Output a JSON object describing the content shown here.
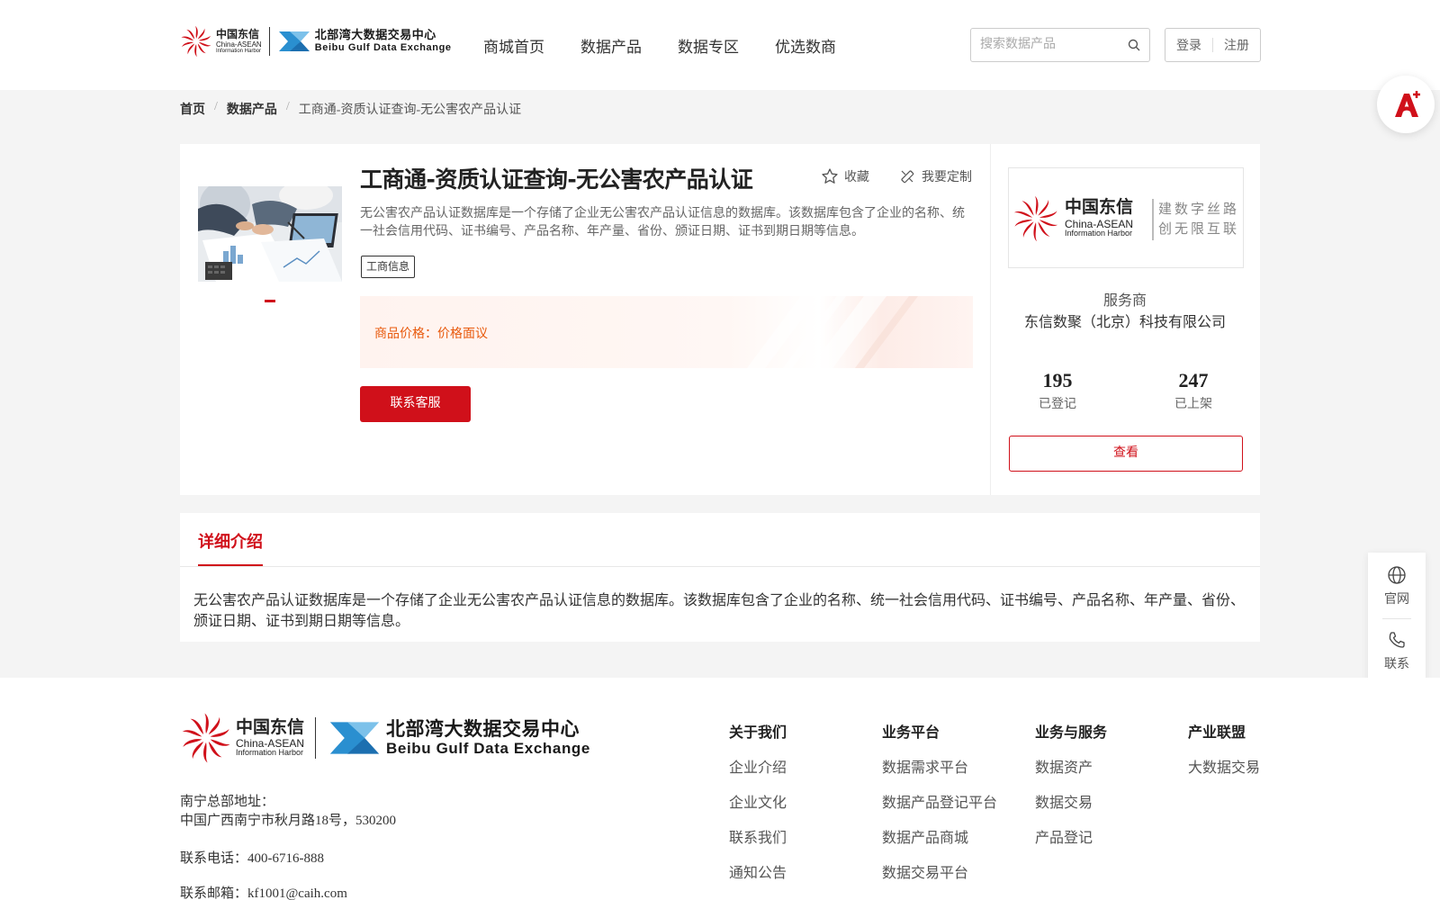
{
  "header": {
    "logo_cn_title": "中国东信",
    "logo_cn_en1": "China-ASEAN",
    "logo_cn_en2": "Information Harbor",
    "logo_bgx_title": "北部湾大数据交易中心",
    "logo_bgx_en": "Beibu Gulf Data Exchange",
    "nav": [
      "商城首页",
      "数据产品",
      "数据专区",
      "优选数商"
    ],
    "search_placeholder": "搜索数据产品",
    "login": "登录",
    "register": "注册"
  },
  "breadcrumb": [
    "首页",
    "数据产品",
    "工商通-资质认证查询-无公害农产品认证"
  ],
  "product": {
    "title": "工商通-资质认证查询-无公害农产品认证",
    "favorite": "收藏",
    "custom": "我要定制",
    "description": "无公害农产品认证数据库是一个存储了企业无公害农产品认证信息的数据库。该数据库包含了企业的名称、统一社会信用代码、证书编号、产品名称、年产量、省份、颁证日期、证书到期日期等信息。",
    "tag": "工商信息",
    "price_label": "商品价格：",
    "price_value": "价格面议",
    "contact_button": "联系客服"
  },
  "provider": {
    "logo_title": "中国东信",
    "logo_en1": "China-ASEAN",
    "logo_en2": "Information Harbor",
    "slogan1": "建数字丝路",
    "slogan2": "创无限互联",
    "label": "服务商",
    "name": "东信数聚（北京）科技有限公司",
    "registered_count": "195",
    "registered_label": "已登记",
    "listed_count": "247",
    "listed_label": "已上架",
    "view_button": "查看"
  },
  "detail": {
    "tab": "详细介绍",
    "text": "无公害农产品认证数据库是一个存储了企业无公害农产品认证信息的数据库。该数据库包含了企业的名称、统一社会信用代码、证书编号、产品名称、年产量、省份、颁证日期、证书到期日期等信息。"
  },
  "side_tools": {
    "website": "官网",
    "contact": "联系"
  },
  "footer": {
    "address_label": "南宁总部地址：",
    "address": "中国广西南宁市秋月路18号，530200",
    "phone": "联系电话：400-6716-888",
    "email": "联系邮箱：kf1001@caih.com",
    "columns": [
      {
        "title": "关于我们",
        "items": [
          "企业介绍",
          "企业文化",
          "联系我们",
          "通知公告"
        ]
      },
      {
        "title": "业务平台",
        "items": [
          "数据需求平台",
          "数据产品登记平台",
          "数据产品商城",
          "数据交易平台"
        ]
      },
      {
        "title": "业务与服务",
        "items": [
          "数据资产",
          "数据交易",
          "产品登记"
        ]
      },
      {
        "title": "产业联盟",
        "items": [
          "大数据交易"
        ]
      }
    ]
  },
  "colors": {
    "brand_red": "#d0101a",
    "price_orange": "#e8590c",
    "bgx_blue": "#2a8fd0"
  }
}
